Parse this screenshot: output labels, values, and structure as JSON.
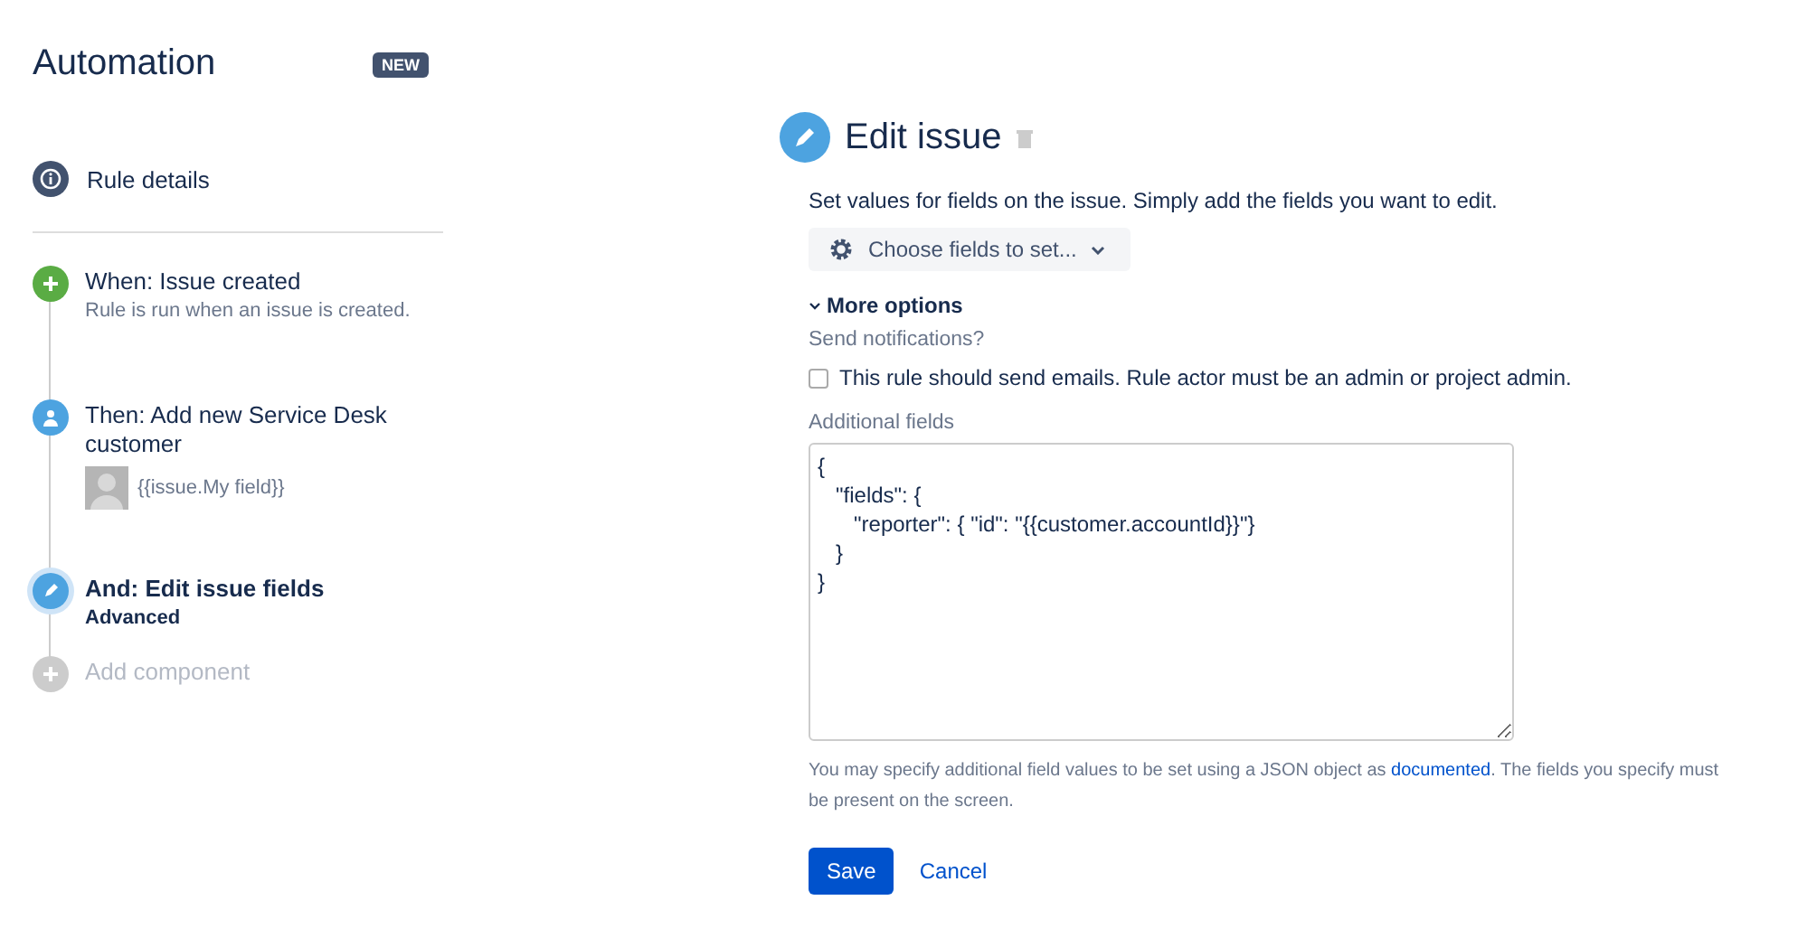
{
  "sidebar": {
    "title": "Automation",
    "badge": "NEW",
    "rule_details": "Rule details",
    "steps": [
      {
        "kind": "trigger",
        "title": "When: Issue created",
        "subtitle": "Rule is run when an issue is created.",
        "selected": false
      },
      {
        "kind": "customer",
        "title": "Then: Add new Service Desk customer",
        "value": "{{issue.My field}}",
        "selected": false
      },
      {
        "kind": "edit",
        "title": "And: Edit issue fields",
        "subtitle": "Advanced",
        "selected": true
      },
      {
        "kind": "add",
        "title": "Add component",
        "selected": false
      }
    ]
  },
  "panel": {
    "title": "Edit issue",
    "description": "Set values for fields on the issue. Simply add the fields you want to edit.",
    "choose_button": "Choose fields to set...",
    "more_options": "More options",
    "expanded": true,
    "notifications_label": "Send notifications?",
    "notifications_checkbox": {
      "label": "This rule should send emails. Rule actor must be an admin or project admin.",
      "checked": false
    },
    "additional_label": "Additional fields",
    "additional_value": "{\n   \"fields\": {\n      \"reporter\": { \"id\": \"{{customer.accountId}}\"}\n   }\n}",
    "help_before": "You may specify additional field values to be set using a JSON object as ",
    "help_link": "documented",
    "help_after": ". The fields you specify must be present on the screen.",
    "save": "Save",
    "cancel": "Cancel"
  }
}
